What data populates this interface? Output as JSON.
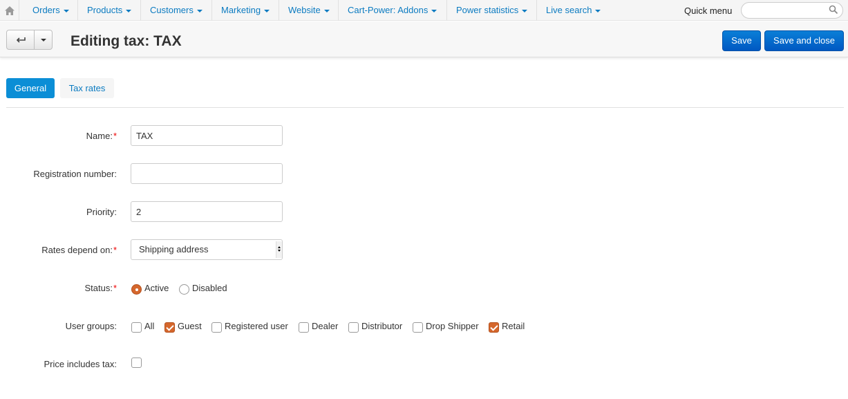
{
  "nav": {
    "home_icon": "home-icon",
    "items": [
      "Orders",
      "Products",
      "Customers",
      "Marketing",
      "Website",
      "Cart-Power: Addons",
      "Power statistics",
      "Live search"
    ],
    "quick_menu": "Quick menu",
    "search_placeholder": ""
  },
  "toolbar": {
    "title": "Editing tax: TAX",
    "save_label": "Save",
    "save_close_label": "Save and close"
  },
  "tabs": [
    {
      "label": "General",
      "active": true
    },
    {
      "label": "Tax rates",
      "active": false
    }
  ],
  "form": {
    "name": {
      "label": "Name:",
      "required": "*",
      "value": "TAX"
    },
    "registration": {
      "label": "Registration number:",
      "value": ""
    },
    "priority": {
      "label": "Priority:",
      "value": "2"
    },
    "rates_depend": {
      "label": "Rates depend on:",
      "required": "*",
      "value": "Shipping address"
    },
    "status": {
      "label": "Status:",
      "required": "*",
      "options": [
        {
          "label": "Active",
          "checked": true
        },
        {
          "label": "Disabled",
          "checked": false
        }
      ]
    },
    "user_groups": {
      "label": "User groups:",
      "options": [
        {
          "label": "All",
          "checked": false
        },
        {
          "label": "Guest",
          "checked": true
        },
        {
          "label": "Registered user",
          "checked": false
        },
        {
          "label": "Dealer",
          "checked": false
        },
        {
          "label": "Distributor",
          "checked": false
        },
        {
          "label": "Drop Shipper",
          "checked": false
        },
        {
          "label": "Retail",
          "checked": true
        }
      ]
    },
    "price_includes_tax": {
      "label": "Price includes tax:",
      "checked": false
    }
  },
  "colors": {
    "accent": "#0b8ed6",
    "link": "#0b7bc1",
    "checked": "#d5672d",
    "required": "#ee0000"
  }
}
